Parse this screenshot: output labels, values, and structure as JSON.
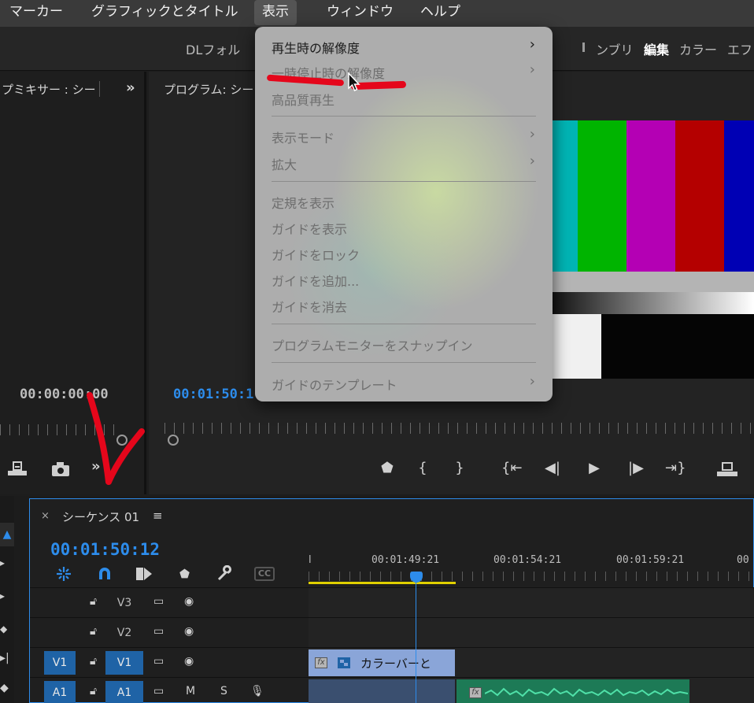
{
  "menubar": {
    "items": [
      "マーカー",
      "グラフィックとタイトル",
      "表示",
      "ウィンドウ",
      "ヘルプ"
    ],
    "active": "表示"
  },
  "workspace_bar": {
    "folder": "DLフォル",
    "tabs": [
      "ンブリ",
      "編集",
      "カラー",
      "エフ"
    ],
    "active_tab": "編集"
  },
  "mixer_panel": {
    "title": "プミキサー : シー",
    "overflow": "»",
    "timecode": "00:00:00:00"
  },
  "program_panel": {
    "title": "プログラム: シー",
    "timecode": "00:01:50:1"
  },
  "view_menu": {
    "items": [
      {
        "label": "再生時の解像度",
        "enabled": true,
        "submenu": true
      },
      {
        "label": "一時停止時の解像度",
        "enabled": false,
        "submenu": true
      },
      {
        "label": "高品質再生",
        "enabled": false,
        "submenu": false
      },
      {
        "label": "表示モード",
        "enabled": false,
        "submenu": true
      },
      {
        "label": "拡大",
        "enabled": false,
        "submenu": true
      },
      {
        "label": "定規を表示",
        "enabled": false,
        "submenu": false
      },
      {
        "label": "ガイドを表示",
        "enabled": false,
        "submenu": false
      },
      {
        "label": "ガイドをロック",
        "enabled": false,
        "submenu": false
      },
      {
        "label": "ガイドを追加...",
        "enabled": false,
        "submenu": false
      },
      {
        "label": "ガイドを消去",
        "enabled": false,
        "submenu": false
      },
      {
        "label": "プログラムモニターをスナップイン",
        "enabled": false,
        "submenu": false
      },
      {
        "label": "ガイドのテンプレート",
        "enabled": false,
        "submenu": true
      }
    ],
    "submenu_arrow": "›"
  },
  "timeline": {
    "close": "×",
    "sequence_name": "シーケンス 01",
    "menu_icon": "≡",
    "timecode": "00:01:50:12",
    "ruler_labels": [
      "00:01:49:21",
      "00:01:54:21",
      "00:01:59:21"
    ],
    "tracks": {
      "v3": "V3",
      "v2": "V2",
      "v1": "V1",
      "v1_source": "V1",
      "a1": "A1",
      "a1_source": "A1",
      "mute": "M",
      "solo": "S"
    },
    "clip_label": "カラーバーと",
    "fx_badge": "fx",
    "cc_label": "CC"
  },
  "colors": {
    "accent_blue": "#2d8ceb",
    "menu_bg": "#adadad",
    "annotation_red": "#e5061b",
    "work_area_yellow": "#e0d000",
    "video_clip": "#8aa5d8",
    "audio_clip": "#1d7a56"
  }
}
